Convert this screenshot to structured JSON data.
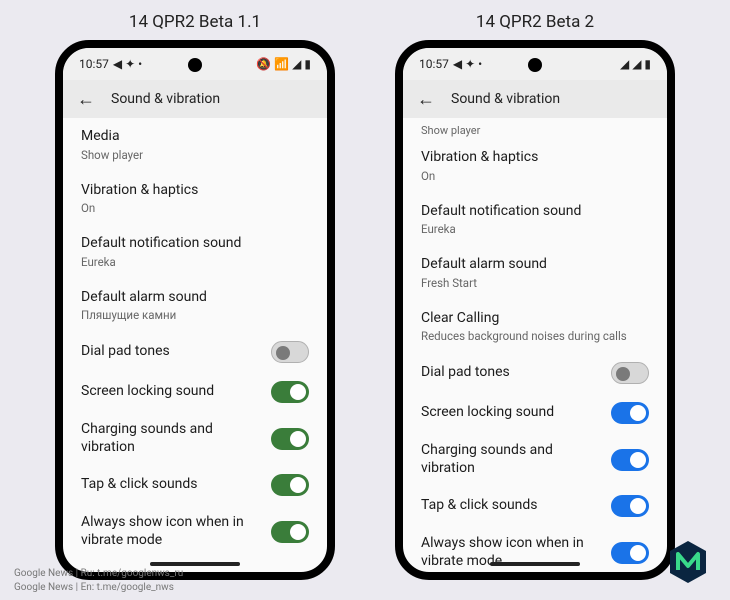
{
  "captions": {
    "left": "14 QPR2 Beta 1.1",
    "right": "14 QPR2 Beta 2"
  },
  "status": {
    "time": "10:57",
    "icons_left": "◀ ✦ •",
    "icons_right_left": "🔕 📶 ◢ ▮",
    "icons_right_right": "◢ ◢ ▮"
  },
  "page": {
    "title": "Sound & vibration"
  },
  "left": {
    "faded": "",
    "items": [
      {
        "title": "Media",
        "sub": "Show player"
      },
      {
        "title": "Vibration & haptics",
        "sub": "On"
      },
      {
        "title": "Default notification sound",
        "sub": "Eureka"
      },
      {
        "title": "Default alarm sound",
        "sub": "Пляшущие камни"
      }
    ],
    "toggles": [
      {
        "label": "Dial pad tones",
        "on": false
      },
      {
        "label": "Screen locking sound",
        "on": true
      },
      {
        "label": "Charging sounds and vibration",
        "on": true
      },
      {
        "label": "Tap & click sounds",
        "on": true
      },
      {
        "label": "Always show icon when in vibrate mode",
        "on": true
      }
    ]
  },
  "right": {
    "faded": "Show player",
    "items": [
      {
        "title": "Vibration & haptics",
        "sub": "On"
      },
      {
        "title": "Default notification sound",
        "sub": "Eureka"
      },
      {
        "title": "Default alarm sound",
        "sub": "Fresh Start"
      },
      {
        "title": "Clear Calling",
        "sub": "Reduces background noises during calls"
      }
    ],
    "toggles": [
      {
        "label": "Dial pad tones",
        "on": false
      },
      {
        "label": "Screen locking sound",
        "on": true
      },
      {
        "label": "Charging sounds and vibration",
        "on": true
      },
      {
        "label": "Tap & click sounds",
        "on": true
      },
      {
        "label": "Always show icon when in vibrate mode",
        "on": true
      }
    ]
  },
  "accent": {
    "left": "on-green",
    "right": "on-blue"
  },
  "footer": {
    "line1": "Google News | Ru: t.me/googlenws_ru",
    "line2": "Google News | En: t.me/google_nws"
  }
}
